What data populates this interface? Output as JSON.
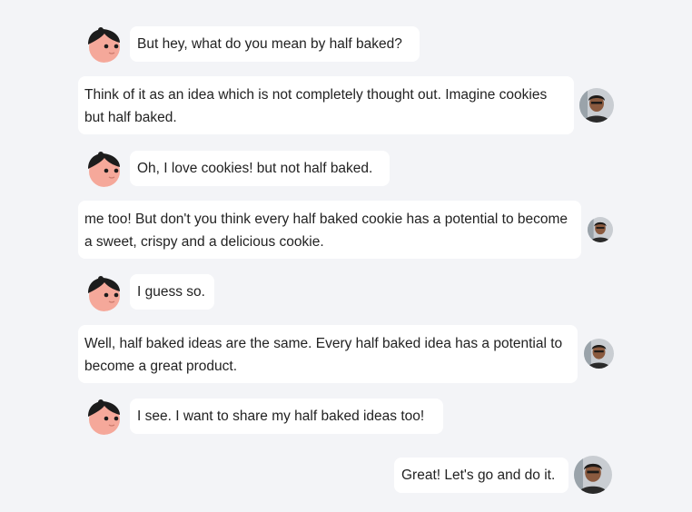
{
  "conversation": {
    "messages": [
      {
        "sender": "bot",
        "text": "But hey, what do you mean by half baked?"
      },
      {
        "sender": "user",
        "text": "Think of it as an idea which is not completely thought out. Imagine cookies but half baked."
      },
      {
        "sender": "bot",
        "text": "Oh, I love cookies! but not half baked."
      },
      {
        "sender": "user",
        "text": "me too! But don't you think every half baked cookie has a potential to become a sweet, crispy and a delicious cookie."
      },
      {
        "sender": "bot",
        "text": "I guess so."
      },
      {
        "sender": "user",
        "text": "Well, half baked ideas are the same. Every half baked idea has a potential to become a great product."
      },
      {
        "sender": "bot",
        "text": "I see. I want to share my half baked ideas too!"
      },
      {
        "sender": "user",
        "text": "Great! Let's go and do it."
      }
    ]
  },
  "colors": {
    "page_background": "#f3f4f7",
    "bubble_background": "#ffffff",
    "text": "#222222",
    "bot_avatar_skin": "#f5a89a",
    "bot_avatar_hair": "#1c1c1c"
  },
  "icons": {
    "bot_avatar": "cartoon-character-avatar-icon",
    "user_avatar": "user-photo-avatar-icon"
  }
}
